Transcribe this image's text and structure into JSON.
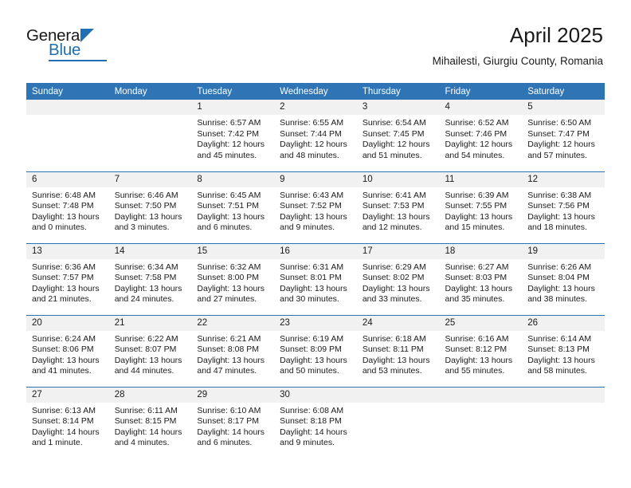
{
  "brand": {
    "name_top": "General",
    "name_bottom": "Blue",
    "accent_color": "#1f6fb4"
  },
  "header": {
    "title": "April 2025",
    "subtitle": "Mihailesti, Giurgiu County, Romania"
  },
  "theme": {
    "header_blue": "#2f74b5",
    "daynum_band": "#f1f1f1",
    "text": "#1a1a1a"
  },
  "weekday_headers": [
    "Sunday",
    "Monday",
    "Tuesday",
    "Wednesday",
    "Thursday",
    "Friday",
    "Saturday"
  ],
  "weeks": [
    [
      {
        "day": "",
        "sunrise": "",
        "sunset": "",
        "daylight_line1": "",
        "daylight_line2": "",
        "empty": true
      },
      {
        "day": "",
        "sunrise": "",
        "sunset": "",
        "daylight_line1": "",
        "daylight_line2": "",
        "empty": true
      },
      {
        "day": "1",
        "sunrise": "Sunrise: 6:57 AM",
        "sunset": "Sunset: 7:42 PM",
        "daylight_line1": "Daylight: 12 hours",
        "daylight_line2": "and 45 minutes."
      },
      {
        "day": "2",
        "sunrise": "Sunrise: 6:55 AM",
        "sunset": "Sunset: 7:44 PM",
        "daylight_line1": "Daylight: 12 hours",
        "daylight_line2": "and 48 minutes."
      },
      {
        "day": "3",
        "sunrise": "Sunrise: 6:54 AM",
        "sunset": "Sunset: 7:45 PM",
        "daylight_line1": "Daylight: 12 hours",
        "daylight_line2": "and 51 minutes."
      },
      {
        "day": "4",
        "sunrise": "Sunrise: 6:52 AM",
        "sunset": "Sunset: 7:46 PM",
        "daylight_line1": "Daylight: 12 hours",
        "daylight_line2": "and 54 minutes."
      },
      {
        "day": "5",
        "sunrise": "Sunrise: 6:50 AM",
        "sunset": "Sunset: 7:47 PM",
        "daylight_line1": "Daylight: 12 hours",
        "daylight_line2": "and 57 minutes."
      }
    ],
    [
      {
        "day": "6",
        "sunrise": "Sunrise: 6:48 AM",
        "sunset": "Sunset: 7:48 PM",
        "daylight_line1": "Daylight: 13 hours",
        "daylight_line2": "and 0 minutes."
      },
      {
        "day": "7",
        "sunrise": "Sunrise: 6:46 AM",
        "sunset": "Sunset: 7:50 PM",
        "daylight_line1": "Daylight: 13 hours",
        "daylight_line2": "and 3 minutes."
      },
      {
        "day": "8",
        "sunrise": "Sunrise: 6:45 AM",
        "sunset": "Sunset: 7:51 PM",
        "daylight_line1": "Daylight: 13 hours",
        "daylight_line2": "and 6 minutes."
      },
      {
        "day": "9",
        "sunrise": "Sunrise: 6:43 AM",
        "sunset": "Sunset: 7:52 PM",
        "daylight_line1": "Daylight: 13 hours",
        "daylight_line2": "and 9 minutes."
      },
      {
        "day": "10",
        "sunrise": "Sunrise: 6:41 AM",
        "sunset": "Sunset: 7:53 PM",
        "daylight_line1": "Daylight: 13 hours",
        "daylight_line2": "and 12 minutes."
      },
      {
        "day": "11",
        "sunrise": "Sunrise: 6:39 AM",
        "sunset": "Sunset: 7:55 PM",
        "daylight_line1": "Daylight: 13 hours",
        "daylight_line2": "and 15 minutes."
      },
      {
        "day": "12",
        "sunrise": "Sunrise: 6:38 AM",
        "sunset": "Sunset: 7:56 PM",
        "daylight_line1": "Daylight: 13 hours",
        "daylight_line2": "and 18 minutes."
      }
    ],
    [
      {
        "day": "13",
        "sunrise": "Sunrise: 6:36 AM",
        "sunset": "Sunset: 7:57 PM",
        "daylight_line1": "Daylight: 13 hours",
        "daylight_line2": "and 21 minutes."
      },
      {
        "day": "14",
        "sunrise": "Sunrise: 6:34 AM",
        "sunset": "Sunset: 7:58 PM",
        "daylight_line1": "Daylight: 13 hours",
        "daylight_line2": "and 24 minutes."
      },
      {
        "day": "15",
        "sunrise": "Sunrise: 6:32 AM",
        "sunset": "Sunset: 8:00 PM",
        "daylight_line1": "Daylight: 13 hours",
        "daylight_line2": "and 27 minutes."
      },
      {
        "day": "16",
        "sunrise": "Sunrise: 6:31 AM",
        "sunset": "Sunset: 8:01 PM",
        "daylight_line1": "Daylight: 13 hours",
        "daylight_line2": "and 30 minutes."
      },
      {
        "day": "17",
        "sunrise": "Sunrise: 6:29 AM",
        "sunset": "Sunset: 8:02 PM",
        "daylight_line1": "Daylight: 13 hours",
        "daylight_line2": "and 33 minutes."
      },
      {
        "day": "18",
        "sunrise": "Sunrise: 6:27 AM",
        "sunset": "Sunset: 8:03 PM",
        "daylight_line1": "Daylight: 13 hours",
        "daylight_line2": "and 35 minutes."
      },
      {
        "day": "19",
        "sunrise": "Sunrise: 6:26 AM",
        "sunset": "Sunset: 8:04 PM",
        "daylight_line1": "Daylight: 13 hours",
        "daylight_line2": "and 38 minutes."
      }
    ],
    [
      {
        "day": "20",
        "sunrise": "Sunrise: 6:24 AM",
        "sunset": "Sunset: 8:06 PM",
        "daylight_line1": "Daylight: 13 hours",
        "daylight_line2": "and 41 minutes."
      },
      {
        "day": "21",
        "sunrise": "Sunrise: 6:22 AM",
        "sunset": "Sunset: 8:07 PM",
        "daylight_line1": "Daylight: 13 hours",
        "daylight_line2": "and 44 minutes."
      },
      {
        "day": "22",
        "sunrise": "Sunrise: 6:21 AM",
        "sunset": "Sunset: 8:08 PM",
        "daylight_line1": "Daylight: 13 hours",
        "daylight_line2": "and 47 minutes."
      },
      {
        "day": "23",
        "sunrise": "Sunrise: 6:19 AM",
        "sunset": "Sunset: 8:09 PM",
        "daylight_line1": "Daylight: 13 hours",
        "daylight_line2": "and 50 minutes."
      },
      {
        "day": "24",
        "sunrise": "Sunrise: 6:18 AM",
        "sunset": "Sunset: 8:11 PM",
        "daylight_line1": "Daylight: 13 hours",
        "daylight_line2": "and 53 minutes."
      },
      {
        "day": "25",
        "sunrise": "Sunrise: 6:16 AM",
        "sunset": "Sunset: 8:12 PM",
        "daylight_line1": "Daylight: 13 hours",
        "daylight_line2": "and 55 minutes."
      },
      {
        "day": "26",
        "sunrise": "Sunrise: 6:14 AM",
        "sunset": "Sunset: 8:13 PM",
        "daylight_line1": "Daylight: 13 hours",
        "daylight_line2": "and 58 minutes."
      }
    ],
    [
      {
        "day": "27",
        "sunrise": "Sunrise: 6:13 AM",
        "sunset": "Sunset: 8:14 PM",
        "daylight_line1": "Daylight: 14 hours",
        "daylight_line2": "and 1 minute."
      },
      {
        "day": "28",
        "sunrise": "Sunrise: 6:11 AM",
        "sunset": "Sunset: 8:15 PM",
        "daylight_line1": "Daylight: 14 hours",
        "daylight_line2": "and 4 minutes."
      },
      {
        "day": "29",
        "sunrise": "Sunrise: 6:10 AM",
        "sunset": "Sunset: 8:17 PM",
        "daylight_line1": "Daylight: 14 hours",
        "daylight_line2": "and 6 minutes."
      },
      {
        "day": "30",
        "sunrise": "Sunrise: 6:08 AM",
        "sunset": "Sunset: 8:18 PM",
        "daylight_line1": "Daylight: 14 hours",
        "daylight_line2": "and 9 minutes."
      },
      {
        "day": "",
        "sunrise": "",
        "sunset": "",
        "daylight_line1": "",
        "daylight_line2": "",
        "empty": true
      },
      {
        "day": "",
        "sunrise": "",
        "sunset": "",
        "daylight_line1": "",
        "daylight_line2": "",
        "empty": true
      },
      {
        "day": "",
        "sunrise": "",
        "sunset": "",
        "daylight_line1": "",
        "daylight_line2": "",
        "empty": true
      }
    ]
  ]
}
